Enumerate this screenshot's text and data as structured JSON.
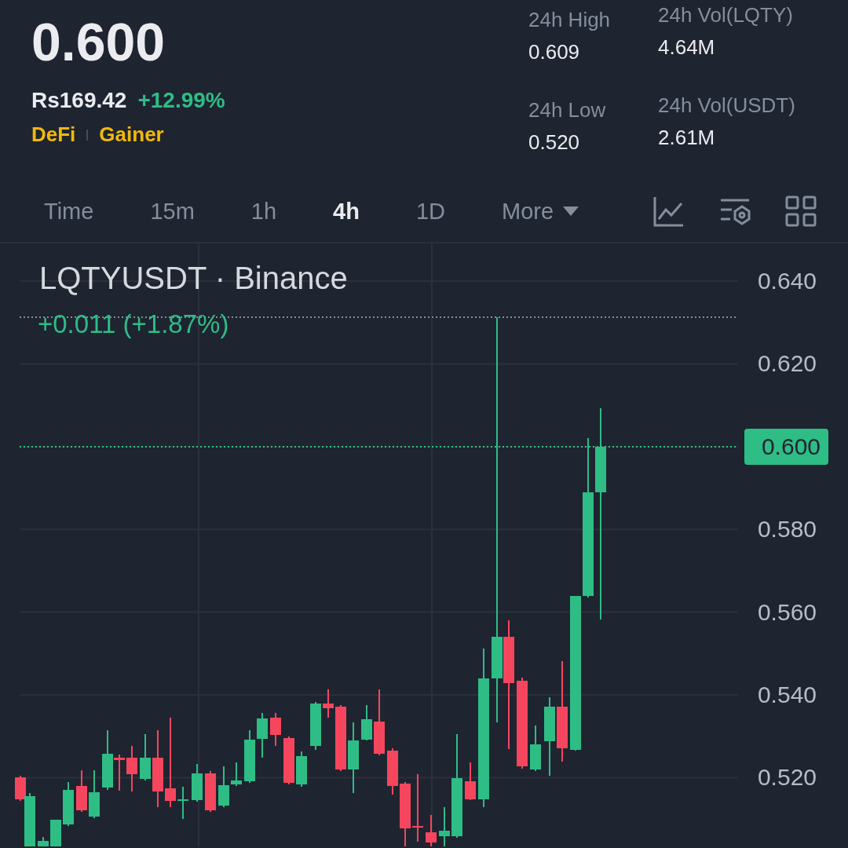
{
  "price": "0.600",
  "fiat_price": "Rs169.42",
  "change": "+12.99%",
  "tags": [
    "DeFi",
    "Gainer"
  ],
  "stats": [
    {
      "label": "24h High",
      "value": "0.609"
    },
    {
      "label": "24h Vol(LQTY)",
      "value": "4.64M"
    },
    {
      "label": "24h Low",
      "value": "0.520"
    },
    {
      "label": "24h Vol(USDT)",
      "value": "2.61M"
    }
  ],
  "intervals": [
    {
      "label": "Time",
      "selected": false,
      "kind": "option"
    },
    {
      "label": "15m",
      "selected": false,
      "kind": "option"
    },
    {
      "label": "1h",
      "selected": false,
      "kind": "option"
    },
    {
      "label": "4h",
      "selected": true,
      "kind": "option"
    },
    {
      "label": "1D",
      "selected": false,
      "kind": "option"
    },
    {
      "label": "More",
      "selected": false,
      "kind": "dropdown"
    }
  ],
  "chart": {
    "symbol": "LQTYUSDT · Binance",
    "change": "+0.011 (+1.87%)",
    "price_axis": [
      {
        "label": "0.640",
        "kind": "tick"
      },
      {
        "label": "0.620",
        "kind": "tick"
      },
      {
        "label": "0.600",
        "kind": "current"
      },
      {
        "label": "0.580",
        "kind": "tick"
      },
      {
        "label": "0.560",
        "kind": "tick"
      },
      {
        "label": "0.540",
        "kind": "tick"
      },
      {
        "label": "0.520",
        "kind": "tick"
      }
    ]
  }
}
